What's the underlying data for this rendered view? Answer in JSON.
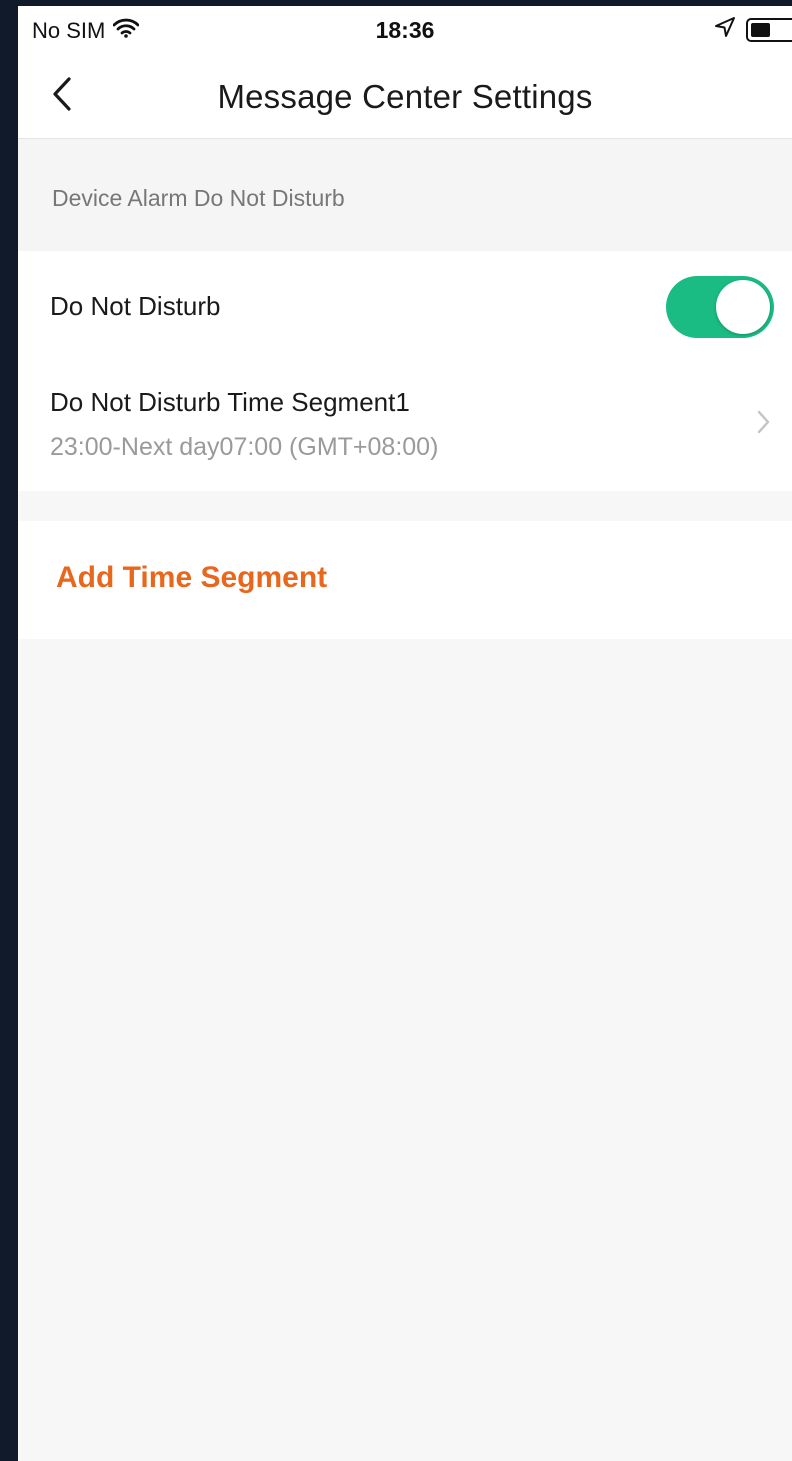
{
  "status_bar": {
    "carrier": "No SIM",
    "time": "18:36",
    "battery_level": 0.5,
    "icons": [
      "wifi-icon",
      "location-arrow-icon",
      "battery-icon"
    ]
  },
  "nav": {
    "title": "Message Center Settings",
    "back_icon": "chevron-left-icon"
  },
  "section": {
    "header": "Device Alarm Do Not Disturb"
  },
  "settings": {
    "dnd_label": "Do Not Disturb",
    "dnd_enabled": true,
    "segment_title": "Do Not Disturb Time Segment1",
    "segment_time": "23:00-Next day07:00 (GMT+08:00)"
  },
  "actions": {
    "add_segment": "Add Time Segment"
  },
  "colors": {
    "toggle_on": "#1bbc83",
    "accent": "#e8671c",
    "background": "#f7f7f7"
  }
}
